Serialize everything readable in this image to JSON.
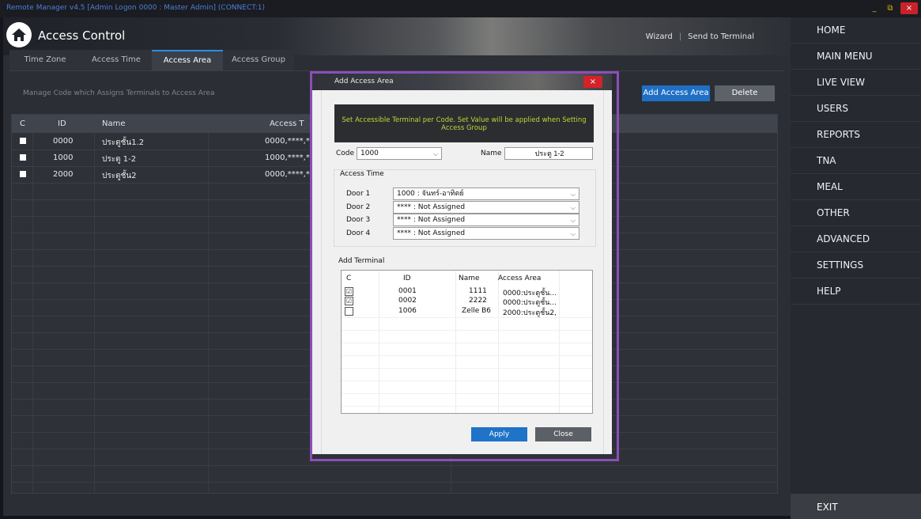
{
  "window": {
    "title": "Remote Manager v4.5 [Admin Logon 0000 : Master Admin] (CONNECT:1)",
    "minimize": "_",
    "restore": "⧉",
    "close": "×"
  },
  "header": {
    "title": "Access Control",
    "wizard": "Wizard",
    "separator": "|",
    "send_to_terminal": "Send to Terminal"
  },
  "tabs": [
    {
      "label": "Time Zone"
    },
    {
      "label": "Access Time"
    },
    {
      "label": "Access Area",
      "active": true
    },
    {
      "label": "Access Group"
    }
  ],
  "description": "Manage Code which Assigns Terminals to Access Area",
  "actions": {
    "add": "Add Access Area",
    "delete": "Delete"
  },
  "table": {
    "columns": [
      "C",
      "ID",
      "Name",
      "Access T"
    ],
    "rows": [
      {
        "id": "0000",
        "name": "ประตูชั้น1.2",
        "access": "0000,****,**"
      },
      {
        "id": "1000",
        "name": "ประตู 1-2",
        "access": "1000,****,**"
      },
      {
        "id": "2000",
        "name": "ประตูชั้น2",
        "access": "0000,****,**"
      }
    ]
  },
  "menu": [
    "HOME",
    "MAIN MENU",
    "LIVE VIEW",
    "USERS",
    "REPORTS",
    "TNA",
    "MEAL",
    "OTHER",
    "ADVANCED",
    "SETTINGS",
    "HELP"
  ],
  "exit_label": "EXIT",
  "dialog": {
    "title": "Add Access Area",
    "close": "×",
    "banner": "Set Accessible Terminal per Code. Set Value will be applied when Setting Access Group",
    "code_label": "Code",
    "code_value": "1000",
    "name_label": "Name",
    "name_value": "ประตู 1-2",
    "access_time_label": "Access Time",
    "doors": [
      {
        "label": "Door 1",
        "value": "1000 : จันทร์-อาทิตย์"
      },
      {
        "label": "Door 2",
        "value": "**** : Not Assigned"
      },
      {
        "label": "Door 3",
        "value": "**** : Not Assigned"
      },
      {
        "label": "Door 4",
        "value": "**** : Not Assigned"
      }
    ],
    "add_terminal_label": "Add Terminal",
    "terminal_columns": [
      "C",
      "ID",
      "Name",
      "Access Area"
    ],
    "terminals": [
      {
        "checked": "☑",
        "id": "0001",
        "name": "1111",
        "area": "0000:ประตูชั้น..."
      },
      {
        "checked": "☑",
        "id": "0002",
        "name": "2222",
        "area": "0000:ประตูชั้น..."
      },
      {
        "checked": "",
        "id": "1006",
        "name": "Zelle B6",
        "area": "2000:ประตูชั้น2,"
      }
    ],
    "apply": "Apply",
    "close_button": "Close"
  }
}
